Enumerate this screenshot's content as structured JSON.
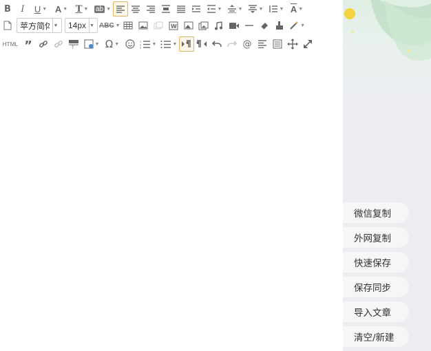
{
  "toolbar": {
    "font_family": "苹方简体",
    "font_size": "14px",
    "html_label": "HTML",
    "spellcheck_label": "ABC"
  },
  "side_buttons": [
    {
      "label": "微信复制"
    },
    {
      "label": "外网复制"
    },
    {
      "label": "快速保存"
    },
    {
      "label": "保存同步"
    },
    {
      "label": "导入文章"
    },
    {
      "label": "清空/新建"
    }
  ]
}
